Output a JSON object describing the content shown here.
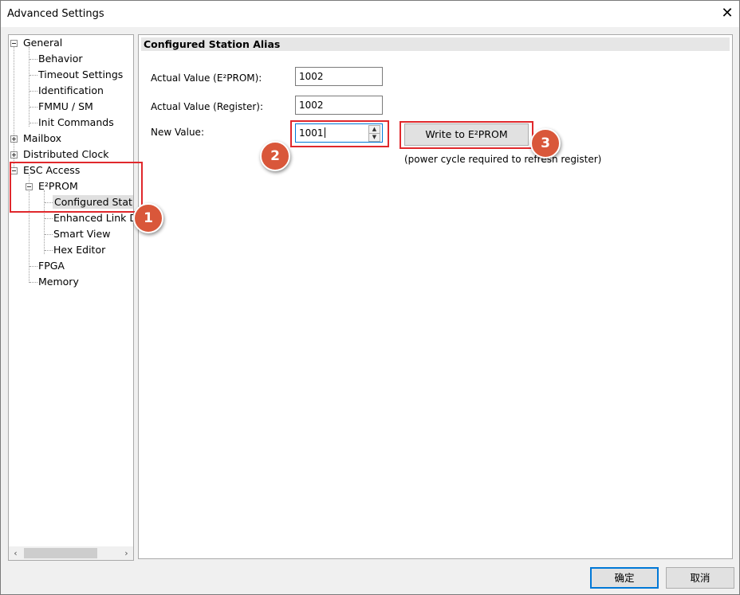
{
  "window": {
    "title": "Advanced Settings",
    "close_glyph": "✕"
  },
  "tree": {
    "items": [
      {
        "label": "General"
      },
      {
        "label": "Behavior"
      },
      {
        "label": "Timeout Settings"
      },
      {
        "label": "Identification"
      },
      {
        "label": "FMMU / SM"
      },
      {
        "label": "Init Commands"
      },
      {
        "label": "Mailbox"
      },
      {
        "label": "Distributed Clock"
      },
      {
        "label": "ESC Access"
      },
      {
        "label": "E²PROM"
      },
      {
        "label": "Configured Station Alias"
      },
      {
        "label": "Enhanced Link Detection"
      },
      {
        "label": "Smart View"
      },
      {
        "label": "Hex Editor"
      },
      {
        "label": "FPGA"
      },
      {
        "label": "Memory"
      }
    ],
    "scroll_left": "‹",
    "scroll_right": "›"
  },
  "panel": {
    "header": "Configured Station Alias",
    "actual_eeprom_label": "Actual Value (E²PROM):",
    "actual_eeprom_value": "1002",
    "actual_register_label": "Actual Value (Register):",
    "actual_register_value": "1002",
    "new_value_label": "New Value:",
    "new_value": "1001",
    "write_button": "Write to E²PROM",
    "note": "(power cycle required to refresn register)"
  },
  "annotations": {
    "step1": "1",
    "step2": "2",
    "step3": "3",
    "color": "#e0282c",
    "badge_color": "#d9573a"
  },
  "buttons": {
    "ok": "确定",
    "cancel": "取消"
  }
}
